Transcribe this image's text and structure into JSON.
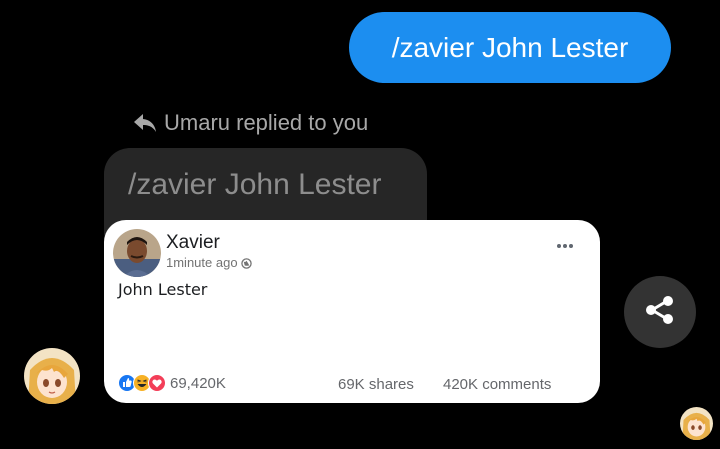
{
  "messages": {
    "sent": {
      "text": "/zavier John Lester"
    },
    "reply": {
      "hint": "Umaru replied to you",
      "quoted_text": "/zavier John Lester"
    }
  },
  "post": {
    "author": "Xavier",
    "time": "1minute ago",
    "body": "John Lester",
    "reaction_count": "69,420K",
    "shares": "69K shares",
    "comments": "420K comments"
  },
  "icons": {
    "reply": "reply-arrow-icon",
    "globe": "globe-icon",
    "more": "more-horizontal-icon",
    "share": "share-icon",
    "like": "like-reaction-icon",
    "haha": "haha-reaction-icon",
    "love": "love-reaction-icon"
  },
  "colors": {
    "sent_bubble": "#1c8ef0",
    "quoted_bubble": "#262626",
    "background": "#000000",
    "like_blue": "#1877f2",
    "love_red": "#f33e58",
    "haha_yellow": "#f7b125"
  }
}
